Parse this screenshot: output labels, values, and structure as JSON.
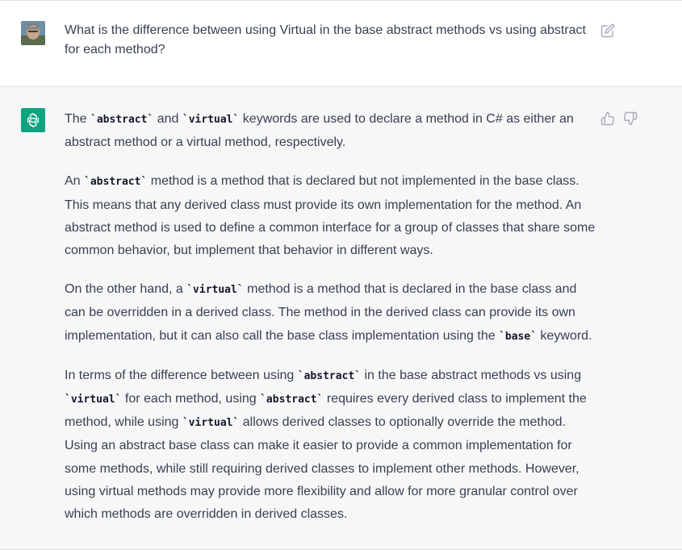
{
  "user_message": {
    "text": "What is the difference between using Virtual in the base abstract methods vs using abstract for each method?"
  },
  "assistant_message": {
    "p1": [
      "The ",
      "`abstract`",
      " and ",
      "`virtual`",
      " keywords are used to declare a method in C# as either an abstract method or a virtual method, respectively."
    ],
    "p2": [
      "An ",
      "`abstract`",
      " method is a method that is declared but not implemented in the base class. This means that any derived class must provide its own implementation for the method. An abstract method is used to define a common interface for a group of classes that share some common behavior, but implement that behavior in different ways."
    ],
    "p3": [
      "On the other hand, a ",
      "`virtual`",
      " method is a method that is declared in the base class and can be overridden in a derived class. The method in the derived class can provide its own implementation, but it can also call the base class implementation using the ",
      "`base`",
      " keyword."
    ],
    "p4": [
      "In terms of the difference between using ",
      "`abstract`",
      " in the base abstract methods vs using ",
      "`virtual`",
      " for each method, using ",
      "`abstract`",
      " requires every derived class to implement the method, while using ",
      "`virtual`",
      " allows derived classes to optionally override the method. Using an abstract base class can make it easier to provide a common implementation for some methods, while still requiring derived classes to implement other methods. However, using virtual methods may provide more flexibility and allow for more granular control over which methods are overridden in derived classes."
    ]
  },
  "icons": {
    "avatar": "user-avatar",
    "edit": "edit-icon",
    "assistant": "openai-logo-icon",
    "like": "thumbs-up-icon",
    "dislike": "thumbs-down-icon"
  },
  "colors": {
    "assistant_bg": "#f7f7f8",
    "logo_bg": "#10a37f",
    "text": "#374151",
    "icon": "#acacbe"
  }
}
